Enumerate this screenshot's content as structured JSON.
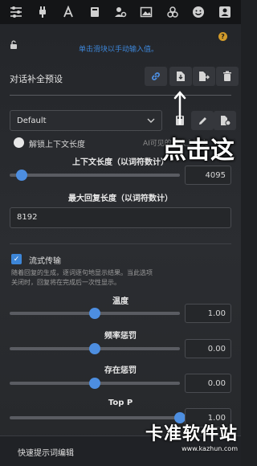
{
  "topbar": {
    "icons": [
      "sliders-icon",
      "plug-icon",
      "font-icon",
      "book-icon",
      "users-gear-icon",
      "image-icon",
      "cubes-icon",
      "smiley-icon",
      "user-icon"
    ]
  },
  "settings": {
    "hint": "单击滑块以手动输入值。",
    "preset_title": "对话补全预设",
    "preset_selected": "Default",
    "context_unlock_label": "解锁上下文长度",
    "context_unlock_note": "AI可见的最大上下文",
    "context_length_label": "上下文长度（以词符数计）",
    "context_length_value": "4095",
    "context_length_fraction": 0.07,
    "max_reply_label": "最大回复长度（以词符数计）",
    "max_reply_value": "8192",
    "streaming_label": "流式传输",
    "streaming_desc": "随着回复的生成，逐词逐句地显示结果。当此选项关闭时，回复将在完成后一次性显示。",
    "temperature_label": "温度",
    "temperature_value": "1.00",
    "temperature_fraction": 0.5,
    "freq_penalty_label": "频率惩罚",
    "freq_penalty_value": "0.00",
    "freq_penalty_fraction": 0.5,
    "presence_penalty_label": "存在惩罚",
    "presence_penalty_value": "0.00",
    "presence_penalty_fraction": 0.5,
    "top_p_label": "Top P",
    "top_p_value": "1.00",
    "top_p_fraction": 1.0,
    "quick_prompt_label": "快速提示词编辑"
  },
  "overlay": {
    "click_text": "点击这",
    "watermark_main": "卡准软件站",
    "watermark_sub": "www.kazhun.com"
  },
  "colors": {
    "accent": "#3d86d8",
    "help_badge": "#d19a2a"
  }
}
